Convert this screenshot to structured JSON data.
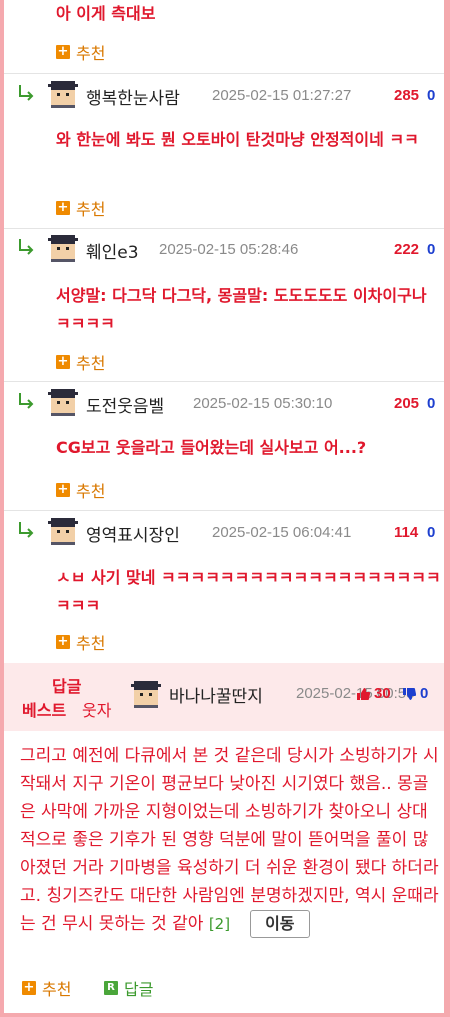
{
  "recommend_label": "추천",
  "reply_label": "답글",
  "comments": [
    {
      "text": "아 이게 측대보"
    },
    {
      "nick": "행복한눈사람",
      "date": "2025-02-15 01:27:27",
      "up": "285",
      "down": "0",
      "text": "와 한눈에 봐도 뭔 오토바이 탄것마냥 안정적이네 ㅋㅋ"
    },
    {
      "nick": "훼인e3",
      "date": "2025-02-15 05:28:46",
      "up": "222",
      "down": "0",
      "text": "서양말: 다그닥 다그닥, 몽골말: 도도도도도 이차이구나 ㅋㅋㅋㅋ"
    },
    {
      "nick": "도전웃음벨",
      "date": "2025-02-15 05:30:10",
      "up": "205",
      "down": "0",
      "text": "CG보고 웃을라고 들어왔는데 실사보고 어...?"
    },
    {
      "nick": "영역표시장인",
      "date": "2025-02-15 06:04:41",
      "up": "114",
      "down": "0",
      "text": "ㅅㅂ 사기 맞네 ㅋㅋㅋㅋㅋㅋㅋㅋㅋㅋㅋㅋㅋㅋㅋㅋㅋㅋㅋㅋㅋㅋ"
    }
  ],
  "best": {
    "tag1": "답글",
    "tag2": "베스트",
    "tag3": "웃자",
    "nick": "바나나꿀딴지",
    "date": "2025-02-15 00:53",
    "up": "30",
    "down": "0",
    "text": "그리고 예전에 다큐에서 본 것 같은데 당시가 소빙하기가 시작돼서 지구 기온이 평균보다 낮아진 시기였다 했음.. 몽골은 사막에 가까운 지형이었는데 소빙하기가 찾아오니 상대적으로 좋은 기후가 된 영향 덕분에 말이 뜯어먹을 풀이 많아졌던 거라 기마병을 육성하기 더 쉬운 환경이 됐다 하더라고. 칭기즈칸도 대단한 사람임엔 분명하겠지만, 역시 운때라는 건 무시 못하는 것 같아",
    "reply_count": "[2]",
    "move_label": "이동"
  }
}
